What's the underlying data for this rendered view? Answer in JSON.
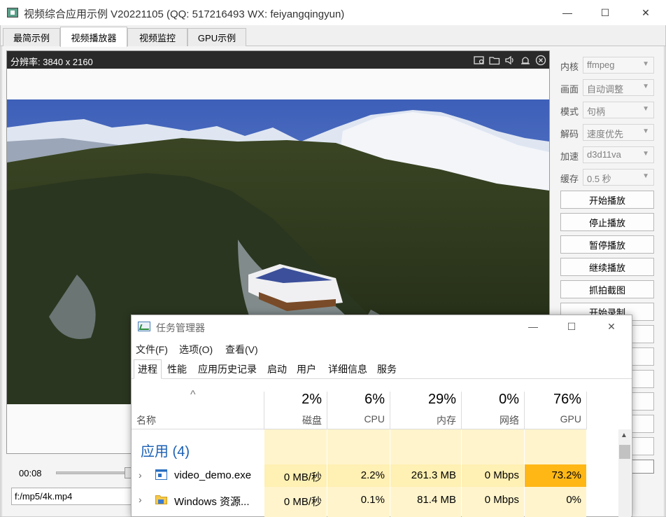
{
  "window": {
    "title": "视频综合应用示例 V20221105 (QQ: 517216493 WX: feiyangqingyun)",
    "minimize": "—",
    "maximize": "☐",
    "close": "✕"
  },
  "tabs": [
    "最简示例",
    "视频播放器",
    "视频监控",
    "GPU示例"
  ],
  "video": {
    "resolution": "分辨率: 3840 x 2160",
    "toolbar_icons": [
      "record-icon",
      "folder-icon",
      "volume-icon",
      "snapshot-icon",
      "close-icon"
    ]
  },
  "settings": [
    {
      "label": "内核",
      "value": "ffmpeg"
    },
    {
      "label": "画面",
      "value": "自动调整"
    },
    {
      "label": "模式",
      "value": "句柄"
    },
    {
      "label": "解码",
      "value": "速度优先"
    },
    {
      "label": "加速",
      "value": "d3d11va"
    },
    {
      "label": "缓存",
      "value": "0.5 秒"
    }
  ],
  "buttons": [
    "开始播放",
    "停止播放",
    "暂停播放",
    "继续播放",
    "抓拍截图",
    "开始录制"
  ],
  "playback": {
    "time": "00:08",
    "path": "f:/mp5/4k.mp4"
  },
  "taskmgr": {
    "title": "任务管理器",
    "menu": [
      "文件(F)",
      "选项(O)",
      "查看(V)"
    ],
    "tabs": [
      "进程",
      "性能",
      "应用历史记录",
      "启动",
      "用户",
      "详细信息",
      "服务"
    ],
    "sort_indicator": "^",
    "name_header": "名称",
    "columns": [
      {
        "pct": "2%",
        "name": "磁盘"
      },
      {
        "pct": "6%",
        "name": "CPU"
      },
      {
        "pct": "29%",
        "name": "内存"
      },
      {
        "pct": "0%",
        "name": "网络"
      },
      {
        "pct": "76%",
        "name": "GPU"
      }
    ],
    "group": "应用 (4)",
    "rows": [
      {
        "name": "video_demo.exe",
        "disk": "0 MB/秒",
        "cpu": "2.2%",
        "mem": "261.3 MB",
        "net": "0 Mbps",
        "gpu": "73.2%"
      },
      {
        "name": "Windows 资源...",
        "disk": "0 MB/秒",
        "cpu": "0.1%",
        "mem": "81.4 MB",
        "net": "0 Mbps",
        "gpu": "0%"
      }
    ]
  }
}
